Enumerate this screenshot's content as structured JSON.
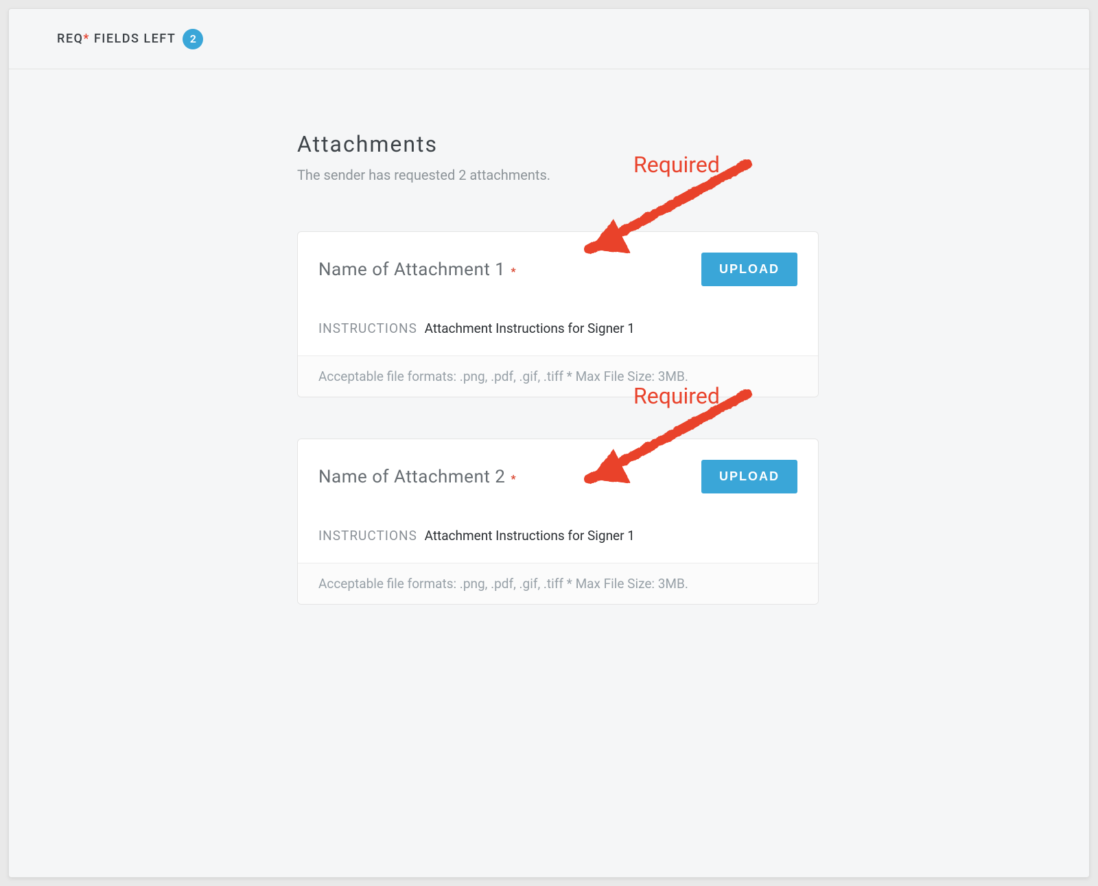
{
  "topbar": {
    "req_label": "REQ",
    "star": "*",
    "fields_left_label": " FIELDS LEFT",
    "count": "2"
  },
  "header": {
    "title": "Attachments",
    "subtitle": "The sender has requested 2 attachments."
  },
  "attachments": [
    {
      "name": "Name of Attachment 1",
      "required_mark": "*",
      "upload_label": "UPLOAD",
      "instructions_label": "INSTRUCTIONS",
      "instructions_text": "Attachment Instructions for Signer 1",
      "footer": "Acceptable file formats: .png, .pdf, .gif, .tiff * Max File Size: 3MB."
    },
    {
      "name": "Name of Attachment 2",
      "required_mark": "*",
      "upload_label": "UPLOAD",
      "instructions_label": "INSTRUCTIONS",
      "instructions_text": "Attachment Instructions for Signer 1",
      "footer": "Acceptable file formats: .png, .pdf, .gif, .tiff * Max File Size: 3MB."
    }
  ],
  "annotations": {
    "required_label": "Required"
  }
}
